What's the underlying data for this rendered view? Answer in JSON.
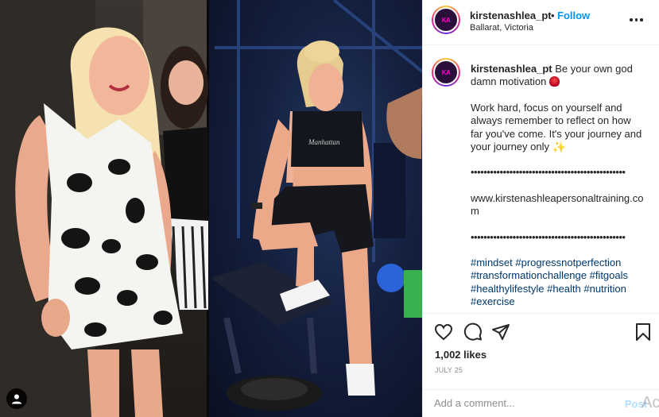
{
  "post": {
    "username": "kirstenashlea_pt",
    "location": "Ballarat, Victoria",
    "follow_label": "Follow",
    "dot": "•",
    "avatar_text": "KA"
  },
  "caption": {
    "line1": "Be your own god damn motivation",
    "line2": "Work hard, focus on yourself and always remember to reflect on how far you've come. It's your journey and your journey only",
    "dots1": "••••••••••••••••••••••••••••••••••••••••••••••••",
    "url": "www.kirstenashleapersonaltraining.com",
    "dots2": "••••••••••••••••••••••••••••••••••••••••••••••••",
    "hashtags": "#mindset #progressnotperfection #transformationchallenge #fitgoals #healthylifestyle #health #nutrition #exercise"
  },
  "stats": {
    "likes": "1,002 likes",
    "date": "JULY 25"
  },
  "comment_box": {
    "placeholder": "Add a comment...",
    "post_label": "Post",
    "overlay": "Act"
  },
  "photo": {
    "left_bg": "#2a2622",
    "right_bg": "#14203f",
    "shorts_text": "Manhattan"
  }
}
